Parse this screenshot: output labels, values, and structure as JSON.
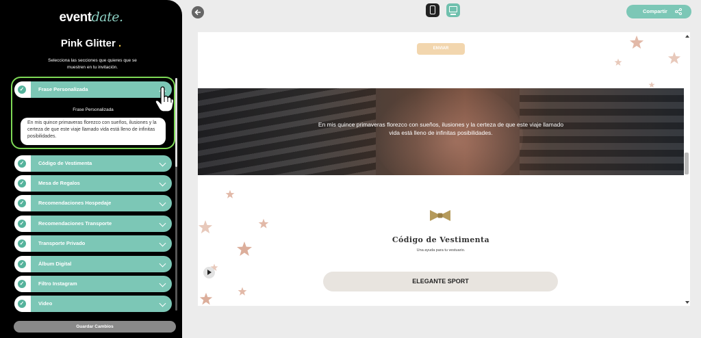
{
  "brand": {
    "logo_main": "event",
    "logo_accent": "date."
  },
  "theme": {
    "name": "Pink Glitter",
    "dot": "."
  },
  "instructions": "Selecciona las secciones que quieres que se muestren en tu invitación.",
  "expanded_section": {
    "label": "Frase Personalizada",
    "field_caption": "Frase Personalizada",
    "field_value": "En mis quince primaveras florezco con sueños, ilusiones y la certeza de que este viaje llamado vida está lleno de infinitas posibilidades."
  },
  "sections": [
    {
      "label": "Código de Vestimenta"
    },
    {
      "label": "Mesa de Regalos"
    },
    {
      "label": "Recomendaciones Hospedaje"
    },
    {
      "label": "Recomendaciones Transporte"
    },
    {
      "label": "Transporte Privado"
    },
    {
      "label": "Álbum Digital"
    },
    {
      "label": "Filtro Instagram"
    },
    {
      "label": "Video"
    }
  ],
  "save_button": "Guardar Cambios",
  "topbar": {
    "share_label": "Compartir"
  },
  "preview": {
    "send_label": "ENVIAR",
    "hero_phrase": "En mis quince primaveras florezco con sueños, ilusiones y la certeza de que este viaje llamado vida está lleno de infinitas posibilidades.",
    "dress_title": "Código de Vestimenta",
    "dress_subtitle": "Una ayuda para tu vestuario.",
    "dress_code": "ELEGANTE SPORT"
  },
  "colors": {
    "accent": "#7cc7b6",
    "active_border": "#7ed957",
    "sidebar_bg": "#000000",
    "send_btn": "#f2d6ae",
    "star": "#e2b9a8"
  }
}
